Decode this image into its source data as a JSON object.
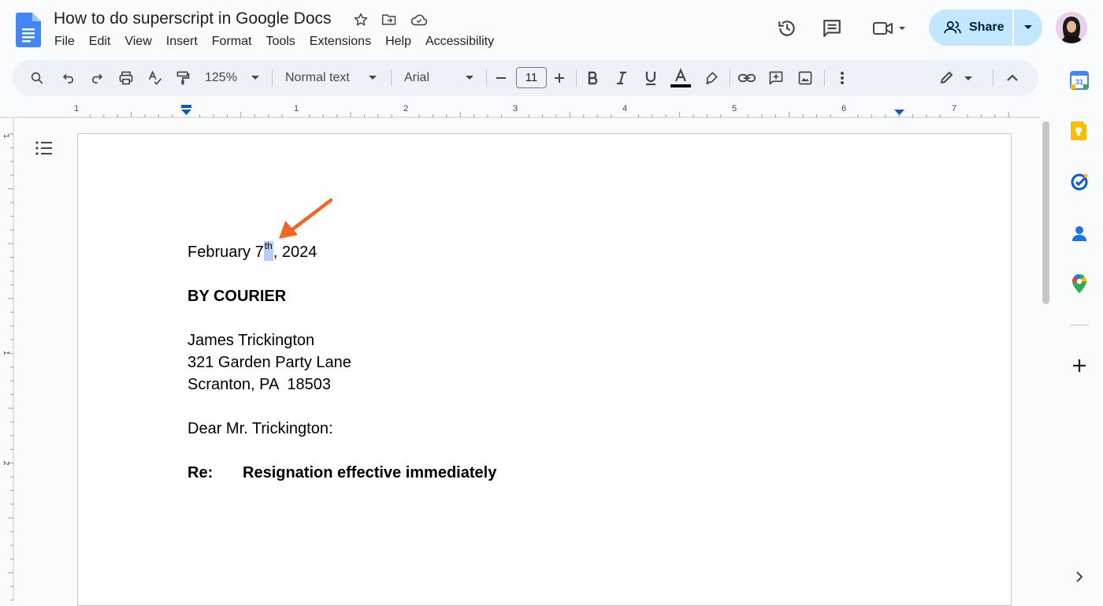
{
  "document": {
    "title": "How to do superscript in Google Docs"
  },
  "menu": [
    "File",
    "Edit",
    "View",
    "Insert",
    "Format",
    "Tools",
    "Extensions",
    "Help",
    "Accessibility"
  ],
  "share": {
    "label": "Share"
  },
  "toolbar": {
    "zoom": "125%",
    "style": "Normal text",
    "font": "Arial",
    "font_size": "11"
  },
  "ruler": {
    "labels": [
      "1",
      "1",
      "2",
      "3",
      "4",
      "5",
      "6",
      "7"
    ]
  },
  "vruler": {
    "labels": [
      "1",
      "1",
      "2"
    ]
  },
  "body": {
    "date_prefix": "February 7",
    "date_sup": "th",
    "date_suffix": ", 2024",
    "delivery": "BY COURIER",
    "address_name": "James Trickington",
    "address_street": "321 Garden Party Lane",
    "address_city": "Scranton, PA  18503",
    "salutation": "Dear Mr. Trickington:",
    "re_label": "Re:",
    "re_subject": "Resignation effective immediately"
  },
  "side_panel": {
    "calendar_day": "31"
  },
  "colors": {
    "accent": "#0b57d0",
    "share_bg": "#c2e7ff",
    "annotation_arrow": "#f26522",
    "selection": "#b6cdf7"
  }
}
